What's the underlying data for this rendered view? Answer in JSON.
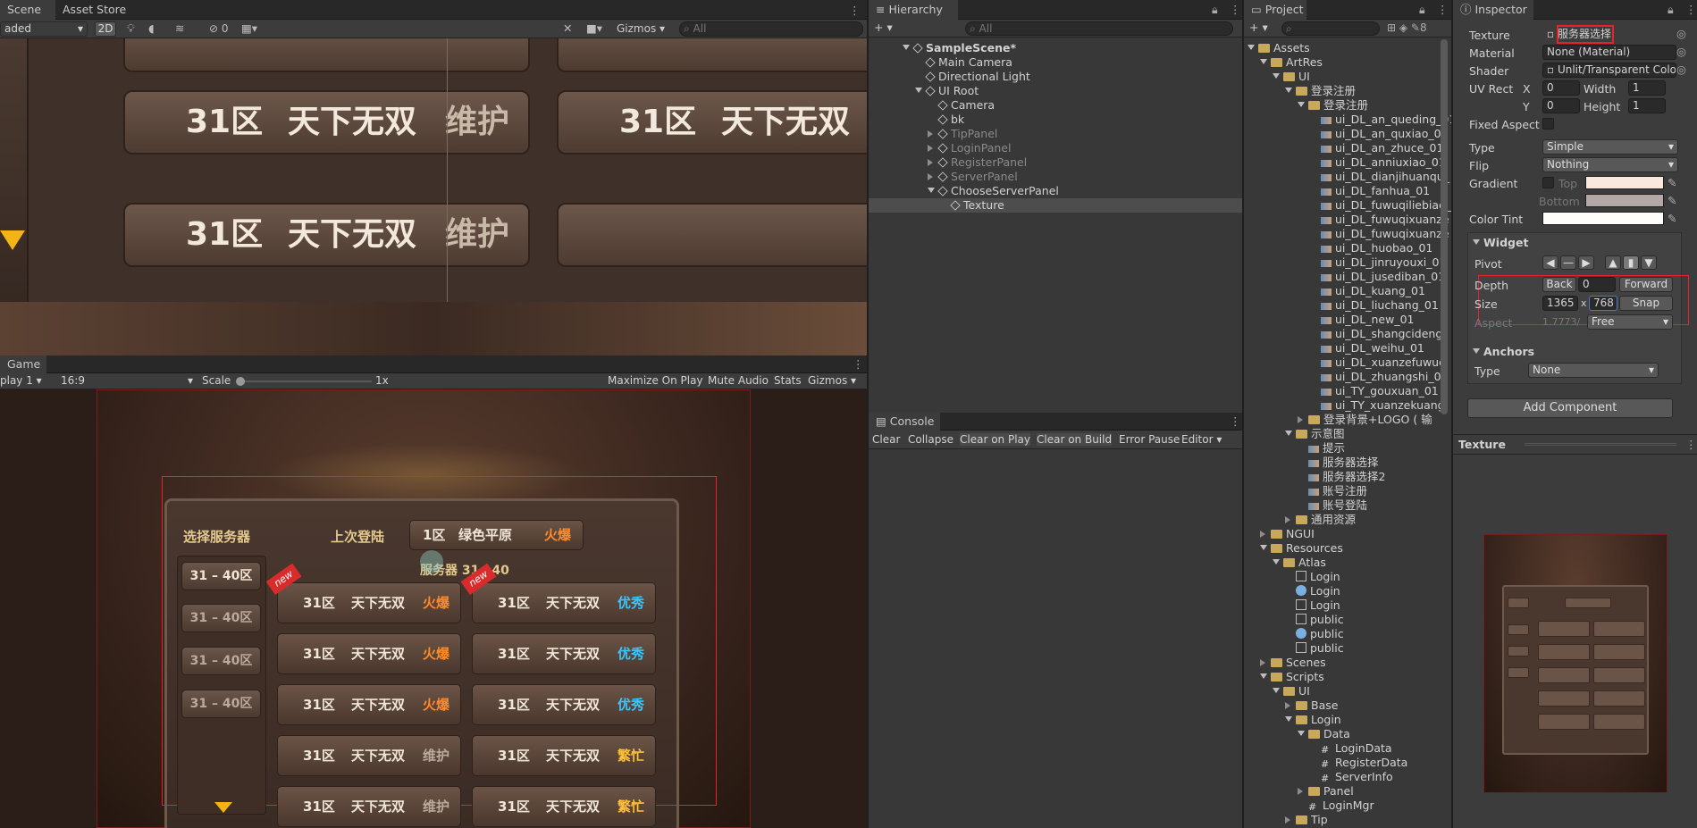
{
  "scene": {
    "tabs": [
      "Scene",
      "Asset Store"
    ],
    "toolbar_left": "aded",
    "mode_2d": "2D",
    "hidden_count": "0",
    "gizmos": "Gizmos",
    "search_placeholder": "All",
    "rows": [
      {
        "zone": "31区",
        "name": "天下无双",
        "status": "维护",
        "zone2": "31区",
        "name2": "天下无双"
      },
      {
        "zone": "31区",
        "name": "天下无双",
        "status": "维护"
      }
    ]
  },
  "game": {
    "tab": "Game",
    "display": "play 1",
    "aspect": "16:9",
    "scale_label": "Scale",
    "scale_value": "1x",
    "buttons": [
      "Maximize On Play",
      "Mute Audio",
      "Stats",
      "Gizmos"
    ],
    "panel": {
      "title": "选择服务器",
      "last_login_label": "上次登陆",
      "last_server_zone": "1区",
      "last_server_name": "绿色平原",
      "last_server_status": "火爆",
      "group_header": "服务器 31—40",
      "side_buttons": [
        "31 – 40区",
        "31 – 40区",
        "31 – 40区",
        "31 – 40区"
      ],
      "new_badge": "new",
      "servers": [
        {
          "zone": "31区",
          "name": "天下无双",
          "status": "火爆",
          "kind": "hot"
        },
        {
          "zone": "31区",
          "name": "天下无双",
          "status": "优秀",
          "kind": "good"
        },
        {
          "zone": "31区",
          "name": "天下无双",
          "status": "火爆",
          "kind": "hot"
        },
        {
          "zone": "31区",
          "name": "天下无双",
          "status": "优秀",
          "kind": "good"
        },
        {
          "zone": "31区",
          "name": "天下无双",
          "status": "火爆",
          "kind": "hot"
        },
        {
          "zone": "31区",
          "name": "天下无双",
          "status": "优秀",
          "kind": "good"
        },
        {
          "zone": "31区",
          "name": "天下无双",
          "status": "维护",
          "kind": "maint"
        },
        {
          "zone": "31区",
          "name": "天下无双",
          "status": "繁忙",
          "kind": "busy"
        },
        {
          "zone": "31区",
          "name": "天下无双",
          "status": "维护",
          "kind": "maint"
        },
        {
          "zone": "31区",
          "name": "天下无双",
          "status": "繁忙",
          "kind": "busy"
        }
      ]
    }
  },
  "hierarchy": {
    "tab": "Hierarchy",
    "search_placeholder": "All",
    "items": [
      {
        "label": "SampleScene*",
        "indent": 0,
        "kind": "scene",
        "expanded": true
      },
      {
        "label": "Main Camera",
        "indent": 1,
        "kind": "obj"
      },
      {
        "label": "Directional Light",
        "indent": 1,
        "kind": "obj"
      },
      {
        "label": "UI Root",
        "indent": 1,
        "kind": "obj",
        "expanded": true
      },
      {
        "label": "Camera",
        "indent": 2,
        "kind": "obj"
      },
      {
        "label": "bk",
        "indent": 2,
        "kind": "obj"
      },
      {
        "label": "TipPanel",
        "indent": 2,
        "kind": "obj",
        "collapsed": true,
        "dim": true
      },
      {
        "label": "LoginPanel",
        "indent": 2,
        "kind": "obj",
        "collapsed": true,
        "dim": true
      },
      {
        "label": "RegisterPanel",
        "indent": 2,
        "kind": "obj",
        "collapsed": true,
        "dim": true
      },
      {
        "label": "ServerPanel",
        "indent": 2,
        "kind": "obj",
        "collapsed": true,
        "dim": true
      },
      {
        "label": "ChooseServerPanel",
        "indent": 2,
        "kind": "obj",
        "expanded": true
      },
      {
        "label": "Texture",
        "indent": 3,
        "kind": "obj",
        "selected": true
      }
    ]
  },
  "console": {
    "tab": "Console",
    "buttons": [
      "Clear",
      "Collapse",
      "Clear on Play",
      "Clear on Build",
      "Error Pause",
      "Editor"
    ]
  },
  "project": {
    "tab": "Project",
    "hidden_count": "8",
    "items": [
      {
        "label": "Assets",
        "indent": 0,
        "kind": "folder",
        "expanded": true
      },
      {
        "label": "ArtRes",
        "indent": 1,
        "kind": "folder",
        "expanded": true
      },
      {
        "label": "UI",
        "indent": 2,
        "kind": "folder",
        "expanded": true
      },
      {
        "label": "登录注册",
        "indent": 3,
        "kind": "folder",
        "expanded": true
      },
      {
        "label": "登录注册",
        "indent": 4,
        "kind": "folder",
        "expanded": true
      },
      {
        "label": "ui_DL_an_queding_01",
        "indent": 5,
        "kind": "img"
      },
      {
        "label": "ui_DL_an_quxiao_01",
        "indent": 5,
        "kind": "img"
      },
      {
        "label": "ui_DL_an_zhuce_01",
        "indent": 5,
        "kind": "img"
      },
      {
        "label": "ui_DL_anniuxiao_01",
        "indent": 5,
        "kind": "img"
      },
      {
        "label": "ui_DL_dianjihuanqu_",
        "indent": 5,
        "kind": "img"
      },
      {
        "label": "ui_DL_fanhua_01",
        "indent": 5,
        "kind": "img"
      },
      {
        "label": "ui_DL_fuwuqiliebiao_",
        "indent": 5,
        "kind": "img"
      },
      {
        "label": "ui_DL_fuwuqixuanze",
        "indent": 5,
        "kind": "img"
      },
      {
        "label": "ui_DL_fuwuqixuanze",
        "indent": 5,
        "kind": "img"
      },
      {
        "label": "ui_DL_huobao_01",
        "indent": 5,
        "kind": "img"
      },
      {
        "label": "ui_DL_jinruyouxi_01",
        "indent": 5,
        "kind": "img"
      },
      {
        "label": "ui_DL_jusediban_01",
        "indent": 5,
        "kind": "img"
      },
      {
        "label": "ui_DL_kuang_01",
        "indent": 5,
        "kind": "img"
      },
      {
        "label": "ui_DL_liuchang_01",
        "indent": 5,
        "kind": "img"
      },
      {
        "label": "ui_DL_new_01",
        "indent": 5,
        "kind": "img"
      },
      {
        "label": "ui_DL_shangcidengl",
        "indent": 5,
        "kind": "img"
      },
      {
        "label": "ui_DL_weihu_01",
        "indent": 5,
        "kind": "img"
      },
      {
        "label": "ui_DL_xuanzefuwuq",
        "indent": 5,
        "kind": "img"
      },
      {
        "label": "ui_DL_zhuangshi_01",
        "indent": 5,
        "kind": "img"
      },
      {
        "label": "ui_TY_gouxuan_01",
        "indent": 5,
        "kind": "img"
      },
      {
        "label": "ui_TY_xuanzekuang",
        "indent": 5,
        "kind": "img"
      },
      {
        "label": "登录背景+LOGO ( 输",
        "indent": 4,
        "kind": "folder",
        "collapsed": true
      },
      {
        "label": "示意图",
        "indent": 3,
        "kind": "folder",
        "expanded": true
      },
      {
        "label": "提示",
        "indent": 4,
        "kind": "img"
      },
      {
        "label": "服务器选择",
        "indent": 4,
        "kind": "img"
      },
      {
        "label": "服务器选择2",
        "indent": 4,
        "kind": "img"
      },
      {
        "label": "账号注册",
        "indent": 4,
        "kind": "img"
      },
      {
        "label": "账号登陆",
        "indent": 4,
        "kind": "img"
      },
      {
        "label": "通用资源",
        "indent": 3,
        "kind": "folder",
        "collapsed": true
      },
      {
        "label": "NGUI",
        "indent": 1,
        "kind": "folder",
        "collapsed": true
      },
      {
        "label": "Resources",
        "indent": 1,
        "kind": "folder",
        "expanded": true
      },
      {
        "label": "Atlas",
        "indent": 2,
        "kind": "folder",
        "expanded": true
      },
      {
        "label": "Login",
        "indent": 3,
        "kind": "asset"
      },
      {
        "label": "Login",
        "indent": 3,
        "kind": "mat"
      },
      {
        "label": "Login",
        "indent": 3,
        "kind": "asset"
      },
      {
        "label": "public",
        "indent": 3,
        "kind": "asset"
      },
      {
        "label": "public",
        "indent": 3,
        "kind": "mat"
      },
      {
        "label": "public",
        "indent": 3,
        "kind": "asset"
      },
      {
        "label": "Scenes",
        "indent": 1,
        "kind": "folder",
        "collapsed": true
      },
      {
        "label": "Scripts",
        "indent": 1,
        "kind": "folder",
        "expanded": true
      },
      {
        "label": "UI",
        "indent": 2,
        "kind": "folder",
        "expanded": true
      },
      {
        "label": "Base",
        "indent": 3,
        "kind": "folder",
        "collapsed": true
      },
      {
        "label": "Login",
        "indent": 3,
        "kind": "folder",
        "expanded": true
      },
      {
        "label": "Data",
        "indent": 4,
        "kind": "folder",
        "expanded": true
      },
      {
        "label": "LoginData",
        "indent": 5,
        "kind": "script"
      },
      {
        "label": "RegisterData",
        "indent": 5,
        "kind": "script"
      },
      {
        "label": "ServerInfo",
        "indent": 5,
        "kind": "script"
      },
      {
        "label": "Panel",
        "indent": 4,
        "kind": "folder",
        "collapsed": true
      },
      {
        "label": "LoginMgr",
        "indent": 4,
        "kind": "script"
      },
      {
        "label": "Tip",
        "indent": 3,
        "kind": "folder",
        "collapsed": true
      }
    ]
  },
  "inspector": {
    "tab": "Inspector",
    "texture_label": "Texture",
    "texture_value": "服务器选择",
    "material_label": "Material",
    "material_value": "None (Material)",
    "shader_label": "Shader",
    "shader_value": "Unlit/Transparent Colo",
    "uvrect_label": "UV Rect",
    "x_label": "X",
    "x_value": "0",
    "y_label": "Y",
    "y_value": "0",
    "width_label": "Width",
    "width_value": "1",
    "height_label": "Height",
    "height_value": "1",
    "fixed_aspect_label": "Fixed Aspect",
    "type_label": "Type",
    "type_value": "Simple",
    "flip_label": "Flip",
    "flip_value": "Nothing",
    "gradient_label": "Gradient",
    "top_label": "Top",
    "bottom_label": "Bottom",
    "color_tint_label": "Color Tint",
    "widget_header": "Widget",
    "pivot_label": "Pivot",
    "depth_label": "Depth",
    "back_label": "Back",
    "depth_value": "0",
    "forward_label": "Forward",
    "size_label": "Size",
    "size_w": "1365",
    "size_x": "x",
    "size_h": "768",
    "snap_label": "Snap",
    "aspect_label": "Aspect",
    "aspect_value": "1.7773/",
    "aspect_mode": "Free",
    "anchors_header": "Anchors",
    "anchors_type_label": "Type",
    "anchors_type_value": "None",
    "add_component": "Add Component",
    "preview_title": "Texture",
    "accent": "#e8222a"
  }
}
